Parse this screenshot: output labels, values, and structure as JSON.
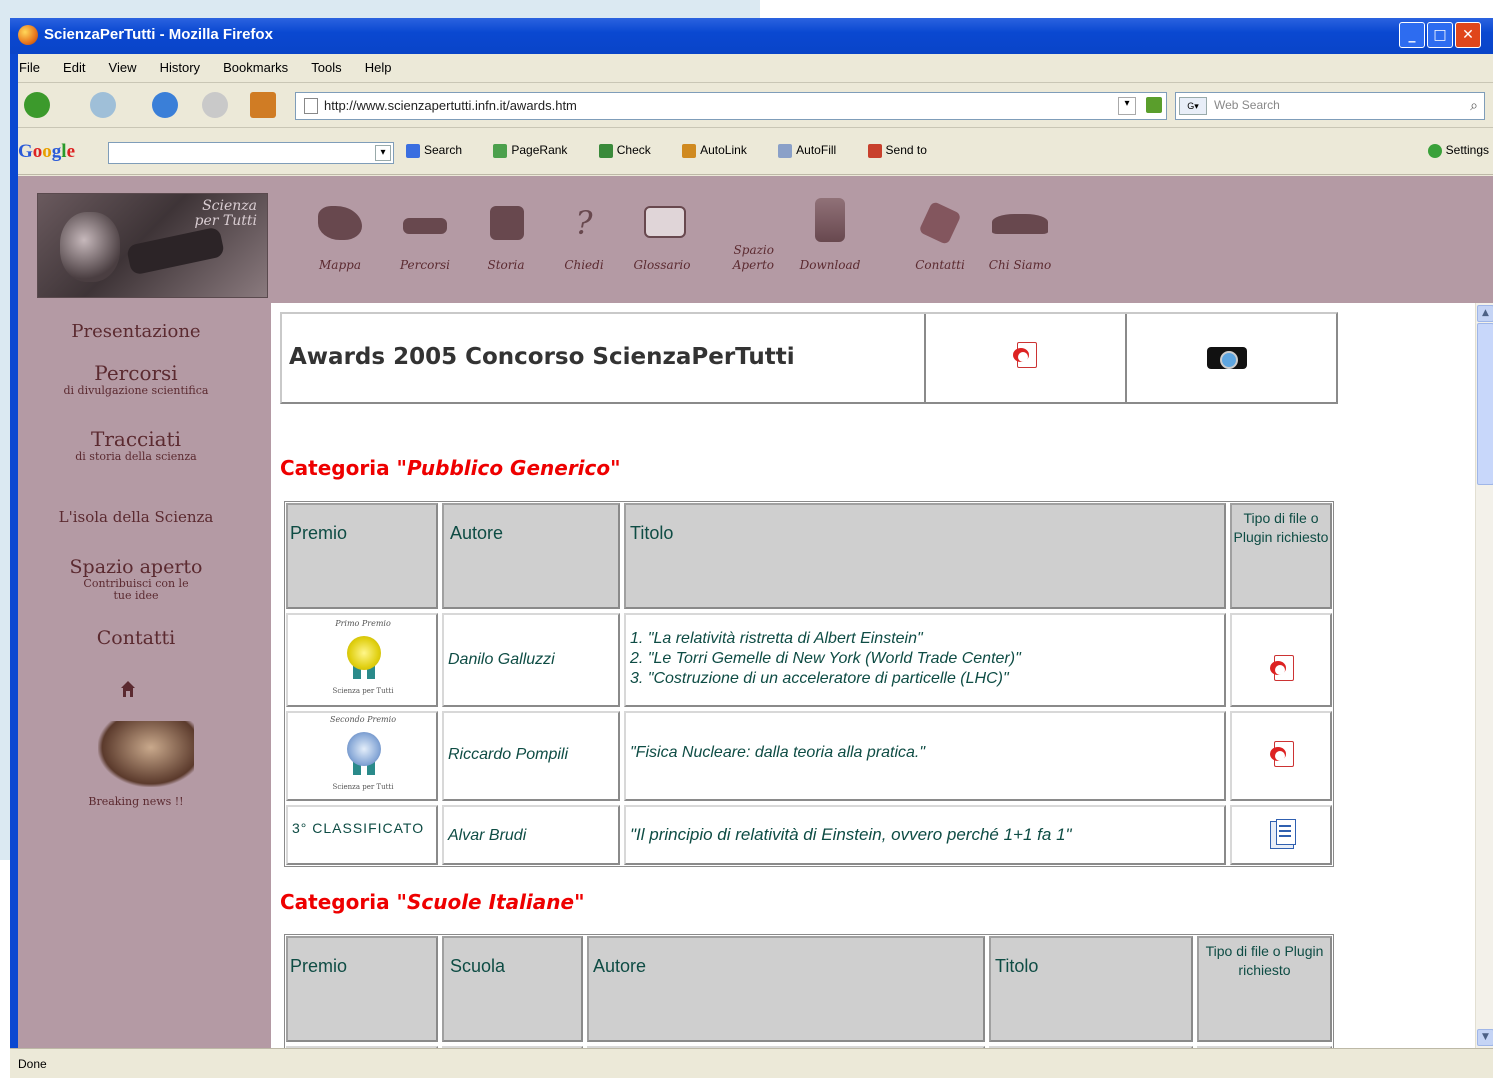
{
  "window": {
    "title": "ScienzaPerTutti - Mozilla Firefox"
  },
  "menubar": [
    "File",
    "Edit",
    "View",
    "History",
    "Bookmarks",
    "Tools",
    "Help"
  ],
  "navbar": {
    "url": "http://www.scienzapertutti.infn.it/awards.htm",
    "search_placeholder": "Web Search"
  },
  "googlebar": {
    "logo": "Google",
    "items": [
      "Search",
      "PageRank",
      "Check",
      "AutoLink",
      "AutoFill",
      "Send to"
    ],
    "settings": "Settings"
  },
  "site": {
    "logo_text": [
      "Scienza",
      "per Tutti"
    ],
    "nav_icons": [
      "Mappa",
      "Percorsi",
      "Storia",
      "Chiedi",
      "Glossario",
      "Spazio Aperto",
      "Download",
      "Contatti",
      "Chi Siamo"
    ],
    "left_nav": [
      {
        "title": "Presentazione",
        "sub": ""
      },
      {
        "title": "Percorsi",
        "sub": "di divulgazione scientifica"
      },
      {
        "title": "Tracciati",
        "sub": "di storia della scienza"
      },
      {
        "title": "L'isola della Scienza",
        "sub": ""
      },
      {
        "title": "Spazio aperto",
        "sub": "Contribuisci con le tue idee"
      },
      {
        "title": "Contatti",
        "sub": ""
      }
    ],
    "news": "Breaking news !!"
  },
  "main": {
    "awards_title": "Awards 2005 Concorso ScienzaPerTutti",
    "cat1": {
      "prefix": "Categoria \"",
      "name": "Pubblico Generico",
      "suffix": "\""
    },
    "table1": {
      "headers": [
        "Premio",
        "Autore",
        "Titolo",
        "Tipo di file o Plugin richiesto"
      ],
      "rows": [
        {
          "premio": "Primo Premio",
          "premio_caption": "Scienza per Tutti",
          "autore": "Danilo Galluzzi",
          "titolo": [
            "1. \"La relatività ristretta di Albert Einstein\"",
            "2. \"Le Torri Gemelle di New York (World Trade Center)\"",
            "3. \"Costruzione di un acceleratore di particelle (LHC)\""
          ],
          "tipo": "pdf"
        },
        {
          "premio": "Secondo Premio",
          "premio_caption": "Scienza per Tutti",
          "autore": "Riccardo Pompili",
          "titolo": [
            "\"Fisica Nucleare: dalla teoria alla pratica.\""
          ],
          "tipo": "pdf"
        },
        {
          "premio": "3° CLASSIFICATO",
          "premio_caption": "",
          "autore": "Alvar Brudi",
          "titolo": [
            "\"Il principio di relatività di Einstein, ovvero perché 1+1 fa 1\""
          ],
          "tipo": "doc"
        }
      ]
    },
    "cat2": {
      "prefix": "Categoria \"",
      "name": "Scuole Italiane",
      "suffix": "\""
    },
    "table2": {
      "headers": [
        "Premio",
        "Scuola",
        "Autore",
        "Titolo",
        "Tipo di file o Plugin richiesto"
      ]
    }
  },
  "statusbar": "Done",
  "colors": {
    "site_bg": "#b49aa4",
    "nav_text": "#5b2a30",
    "category_red": "#ee0000",
    "table_text": "#0e4c44",
    "header_bg": "#cfcfcf"
  }
}
